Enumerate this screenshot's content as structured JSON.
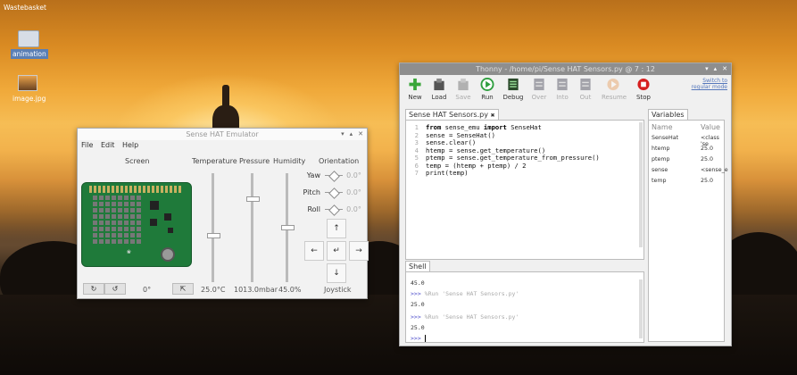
{
  "desktop": {
    "icons": [
      {
        "label": "Wastebasket"
      },
      {
        "label": "animation"
      },
      {
        "label": "image.jpg"
      }
    ]
  },
  "emulator": {
    "title": "Sense HAT Emulator",
    "menu": [
      "File",
      "Edit",
      "Help"
    ],
    "columns": {
      "screen": "Screen",
      "temperature": "Temperature",
      "pressure": "Pressure",
      "humidity": "Humidity",
      "orientation": "Orientation"
    },
    "rotate_left": "↻",
    "rotate_right": "↺",
    "rotation_value": "0°",
    "export_icon": "⇱",
    "temperature_value": "25.0°C",
    "pressure_value": "1013.0mbar",
    "humidity_value": "45.0%",
    "temperature_level": 0.58,
    "pressure_level": 0.78,
    "humidity_level": 0.5,
    "orientation": [
      {
        "label": "Yaw",
        "value": "0.0°"
      },
      {
        "label": "Pitch",
        "value": "0.0°"
      },
      {
        "label": "Roll",
        "value": "0.0°"
      }
    ],
    "joystick": {
      "label": "Joystick",
      "up": "↑",
      "down": "↓",
      "left": "←",
      "right": "→",
      "enter": "↵"
    }
  },
  "thonny": {
    "title": "Thonny  -  /home/pi/Sense HAT Sensors.py  @  7 : 12",
    "switch_mode": [
      "Switch to",
      "regular mode"
    ],
    "toolbar": [
      {
        "label": "New",
        "icon": "new-icon"
      },
      {
        "label": "Load",
        "icon": "load-icon"
      },
      {
        "label": "Save",
        "icon": "save-icon"
      },
      {
        "label": "Run",
        "icon": "run-icon"
      },
      {
        "label": "Debug",
        "icon": "debug-icon"
      },
      {
        "label": "Over",
        "icon": "step-over-icon"
      },
      {
        "label": "Into",
        "icon": "step-into-icon"
      },
      {
        "label": "Out",
        "icon": "step-out-icon"
      },
      {
        "label": "Resume",
        "icon": "resume-icon"
      },
      {
        "label": "Stop",
        "icon": "stop-icon"
      }
    ],
    "editor_tab": "Sense HAT Sensors.py",
    "editor_tab_close": "✖",
    "line_numbers": [
      "1",
      "2",
      "3",
      "4",
      "5",
      "6",
      "7"
    ],
    "code": [
      [
        "from",
        " sense_emu ",
        "import",
        " SenseHat"
      ],
      [
        "",
        "sense = SenseHat()",
        "",
        ""
      ],
      [
        "",
        "sense.clear()",
        "",
        ""
      ],
      [
        "",
        "htemp = sense.get_temperature()",
        "",
        ""
      ],
      [
        "",
        "ptemp = sense.get_temperature_from_pressure()",
        "",
        ""
      ],
      [
        "",
        "temp = (htemp + ptemp) / 2",
        "",
        ""
      ],
      [
        "",
        "print(temp)",
        "",
        ""
      ]
    ],
    "variables_tab": "Variables",
    "variables_headers": {
      "name": "Name",
      "value": "Value"
    },
    "variables": [
      {
        "name": "SenseHat",
        "value": "<class 'se"
      },
      {
        "name": "htemp",
        "value": "25.0"
      },
      {
        "name": "ptemp",
        "value": "25.0"
      },
      {
        "name": "sense",
        "value": "<sense_e"
      },
      {
        "name": "temp",
        "value": "25.0"
      }
    ],
    "shell_tab": "Shell",
    "shell": {
      "l1": "45.0",
      "p1": ">>>",
      "c1": "%Run 'Sense HAT Sensors.py'",
      "l2": "25.0",
      "p2": ">>>",
      "c2": "%Run 'Sense HAT Sensors.py'",
      "l3": "25.0",
      "p3": ">>>"
    }
  }
}
